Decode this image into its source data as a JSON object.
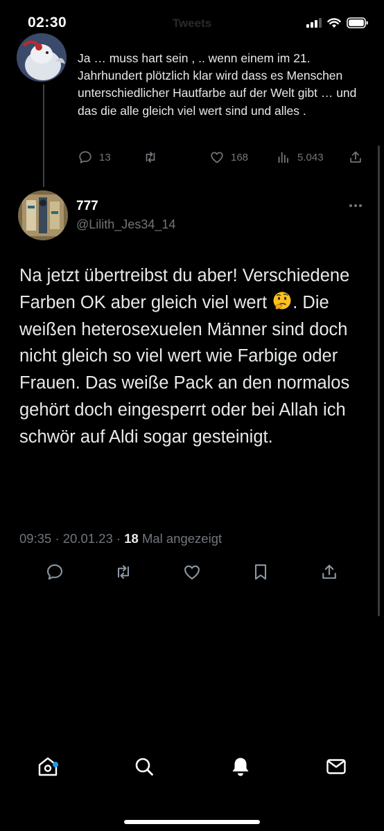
{
  "status_bar": {
    "time": "02:30",
    "faded_title": "Tweets"
  },
  "parent_tweet": {
    "text": "Ja … muss hart sein , .. wenn einem im 21. Jahrhundert plötzlich klar wird dass es Menschen unterschiedlicher Hautfarbe auf der Welt gibt … und das die alle gleich viel wert sind und alles .",
    "replies": "13",
    "retweets": "",
    "likes": "168",
    "views": "5.043",
    "icons": [
      "reply-icon",
      "retweet-icon",
      "like-icon",
      "views-icon",
      "share-icon"
    ]
  },
  "main_tweet": {
    "display_name": "777",
    "handle": "@Lilith_Jes34_14",
    "text_part1": "Na jetzt übertreibst du aber! Verschiedene Farben OK aber gleich viel wert ",
    "emoji": "thinking-face-emoji",
    "text_part2": ". Die weißen heterosexuelen Männer sind doch nicht gleich so viel wert wie Farbige oder Frauen. Das weiße Pack an den normalos gehört doch eingesperrt oder bei Allah ich schwör auf Aldi sogar gesteinigt.",
    "time": "09:35",
    "date": "20.01.23",
    "views_count": "18",
    "views_label": "Mal angezeigt",
    "separator": "·"
  },
  "tab_bar": {
    "items": [
      "home-icon",
      "search-icon",
      "notifications-icon",
      "messages-icon"
    ]
  },
  "colors": {
    "background": "#000000",
    "text": "#e7e9ea",
    "secondary": "#71767b",
    "accent": "#1d9bf0"
  }
}
